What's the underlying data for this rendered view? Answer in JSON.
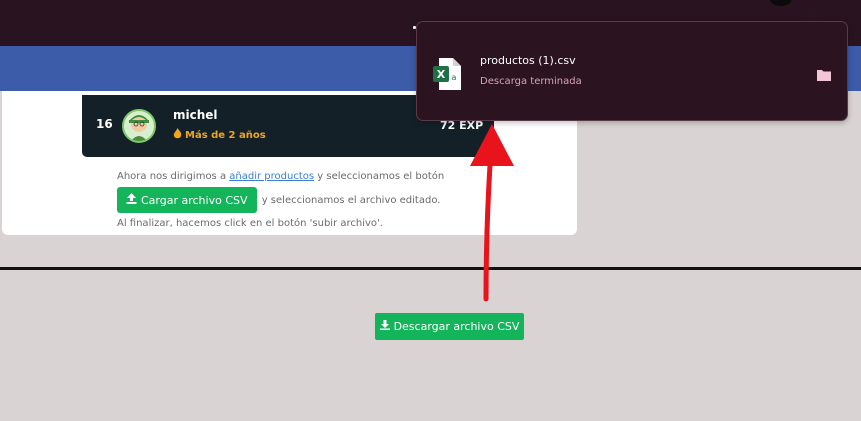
{
  "leaderboard_entry": {
    "rank": "16",
    "name": "michel",
    "badge": "Más de 2 años",
    "exp": "72 EXP"
  },
  "instructions": {
    "part1": "Ahora nos dirigimos a ",
    "link": "añadir productos",
    "part2": " y seleccionamos el botón",
    "button_label": "Cargar archivo CSV",
    "part3": "y seleccionamos el archivo editado. Al finalizar, hacemos click en el botón 'subir archivo'."
  },
  "download_button": {
    "label": "Descargar archivo CSV"
  },
  "download_popup": {
    "file_name": "productos (1).csv",
    "status": "Descarga terminada"
  },
  "icons": [
    "excel-file-icon",
    "folder-icon",
    "upload-icon",
    "download-icon",
    "flame-icon"
  ],
  "colors": {
    "accent_green": "#14b45a",
    "top_bar": "#2a1320",
    "blue_bar": "#3c5ba8",
    "badge_orange": "#f2a51b",
    "annotation_arrow": "#e8131b"
  }
}
